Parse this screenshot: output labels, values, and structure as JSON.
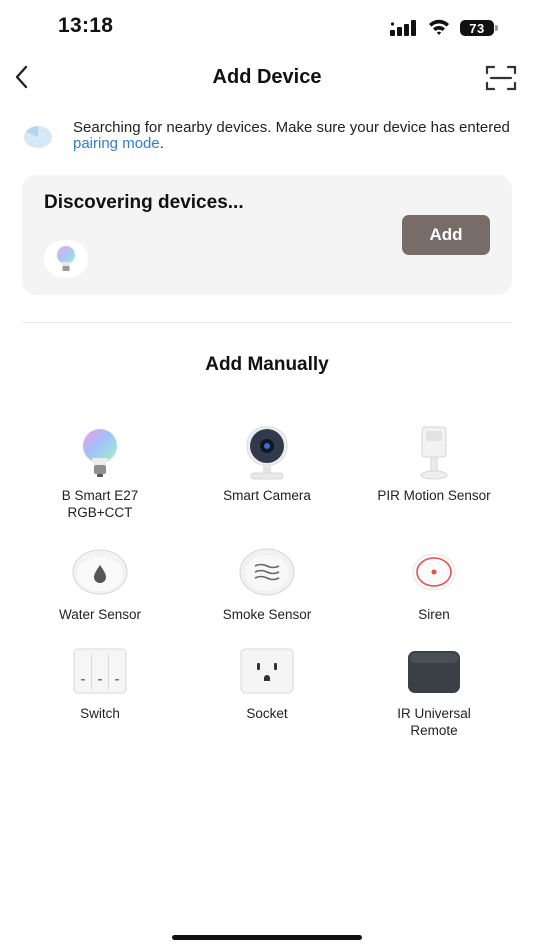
{
  "status_bar": {
    "time": "13:18",
    "battery": "73"
  },
  "header": {
    "title": "Add Device"
  },
  "search": {
    "text_before_link": "Searching for nearby devices. Make sure your device has entered ",
    "link": "pairing mode",
    "text_after_link": "."
  },
  "discover": {
    "title": "Discovering devices...",
    "add_label": "Add"
  },
  "manual": {
    "title": "Add Manually",
    "items": [
      {
        "label": "B Smart E27\nRGB+CCT",
        "icon": "bulb-icon"
      },
      {
        "label": "Smart Camera",
        "icon": "camera-icon"
      },
      {
        "label": "PIR Motion Sensor",
        "icon": "motion-sensor-icon"
      },
      {
        "label": "Water Sensor",
        "icon": "water-sensor-icon"
      },
      {
        "label": "Smoke Sensor",
        "icon": "smoke-sensor-icon"
      },
      {
        "label": "Siren",
        "icon": "siren-icon"
      },
      {
        "label": "Switch",
        "icon": "switch-icon"
      },
      {
        "label": "Socket",
        "icon": "socket-icon"
      },
      {
        "label": "IR Universal\nRemote",
        "icon": "ir-remote-icon"
      }
    ]
  },
  "colors": {
    "link": "#2f7fd1",
    "add_button": "#776c67",
    "card_bg": "#f4f4f4"
  }
}
